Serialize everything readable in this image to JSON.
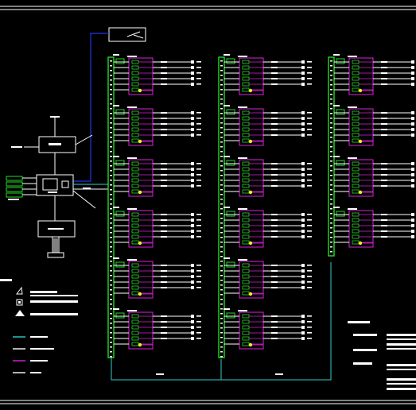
{
  "drawing": {
    "colors": {
      "background": "#000000",
      "frame": "#ffffff",
      "bus": "#22dd22",
      "circuit": "#dd22dd",
      "link_cyan": "#33cccc",
      "link_blue": "#2233ee",
      "indicator": "#eeee22"
    },
    "columns": [
      {
        "id": "column-1",
        "groups": 6
      },
      {
        "id": "column-2",
        "groups": 6
      },
      {
        "id": "column-3",
        "groups": 4
      }
    ],
    "group_rows": 6,
    "legend_lines": [
      {
        "color": "#33cccc"
      },
      {
        "color": "#ffffff"
      },
      {
        "color": "#dd22dd"
      },
      {
        "color": "#ffffff"
      }
    ],
    "symbols": [
      {
        "icon": "triangle-outline-icon"
      },
      {
        "icon": "square-marker-icon"
      },
      {
        "icon": "filled-triangle-icon"
      }
    ]
  }
}
